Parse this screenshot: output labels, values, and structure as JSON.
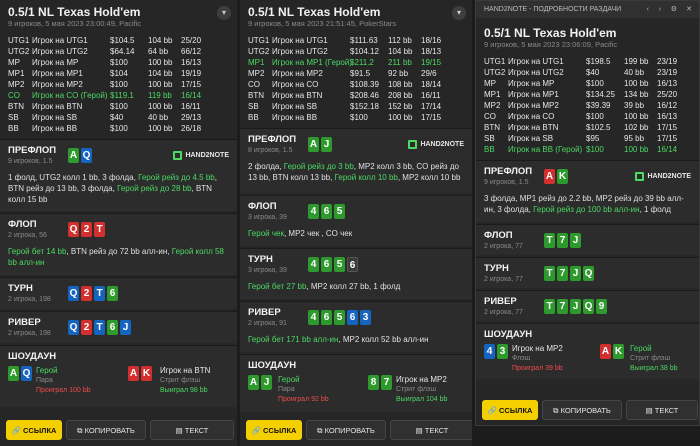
{
  "p1": {
    "title": "0.5/1 NL Texas Hold'em",
    "sub": "9 игроков, 5 мая 2023 23:00:49, Pacific",
    "players": [
      {
        "pos": "UTG1",
        "name": "Игрок на UTG1",
        "stack": "$104.5",
        "bb": "104 bb",
        "ratio": "25/20"
      },
      {
        "pos": "UTG2",
        "name": "Игрок на UTG2",
        "stack": "$64.14",
        "bb": "64 bb",
        "ratio": "66/12"
      },
      {
        "pos": "MP",
        "name": "Игрок на MP",
        "stack": "$100",
        "bb": "100 bb",
        "ratio": "16/13"
      },
      {
        "pos": "MP1",
        "name": "Игрок на MP1",
        "stack": "$104",
        "bb": "104 bb",
        "ratio": "19/19"
      },
      {
        "pos": "MP2",
        "name": "Игрок на MP2",
        "stack": "$100",
        "bb": "100 bb",
        "ratio": "17/15"
      },
      {
        "pos": "CO",
        "name": "Игрок на CO (Герой)",
        "stack": "$119.1",
        "bb": "119 bb",
        "ratio": "16/14",
        "hero": true
      },
      {
        "pos": "BTN",
        "name": "Игрок на BTN",
        "stack": "$100",
        "bb": "100 bb",
        "ratio": "16/11"
      },
      {
        "pos": "SB",
        "name": "Игрок на SB",
        "stack": "$40",
        "bb": "40 bb",
        "ratio": "29/13"
      },
      {
        "pos": "BB",
        "name": "Игрок на BB",
        "stack": "$100",
        "bb": "100 bb",
        "ratio": "26/18"
      }
    ],
    "preflop": {
      "t": "ПРЕФЛОП",
      "s": "9 игроков, 1.5",
      "a1": "1 фолд, UTG2 колл 1 bb, 3 фолда, ",
      "a2": "Герой рейз до 4.5 bb",
      "a3": ", BTN ",
      "a4": "рейз до 13 bb",
      "a5": ", 3 фолда, ",
      "a6": "Герой рейз до 28 bb",
      "a7": ", BTN колл 15 bb"
    },
    "flop": {
      "t": "ФЛОП",
      "s": "2 игрока, 56",
      "a1": "Герой бет 14 bb",
      "a2": ", BTN рейз до 72 bb алл-ин, ",
      "a3": "Герой колл 58 bb алл-ин"
    },
    "turn": {
      "t": "ТУРН",
      "s": "2 игрока, 198"
    },
    "river": {
      "t": "РИВЕР",
      "s": "2 игрока, 198"
    },
    "showdown": {
      "t": "ШОУДАУН",
      "h_name": "Герой",
      "h_desc": "Пара",
      "h_res": "Проиграл 100 bb",
      "v_name": "Игрок на BTN",
      "v_desc": "Стрит флэш",
      "v_res": "Выиграл 98 bb"
    }
  },
  "p2": {
    "title": "0.5/1 NL Texas Hold'em",
    "sub": "9 игроков, 5 мая 2023 21:51:45, PokerStars",
    "players": [
      {
        "pos": "UTG1",
        "name": "Игрок на UTG1",
        "stack": "$111.63",
        "bb": "112 bb",
        "ratio": "18/16"
      },
      {
        "pos": "UTG2",
        "name": "Игрок на UTG2",
        "stack": "$104.12",
        "bb": "104 bb",
        "ratio": "18/13"
      },
      {
        "pos": "MP1",
        "name": "Игрок на MP1 (Герой)",
        "stack": "$211.2",
        "bb": "211 bb",
        "ratio": "19/15",
        "hero": true
      },
      {
        "pos": "MP2",
        "name": "Игрок на MP2",
        "stack": "$91.5",
        "bb": "92 bb",
        "ratio": "29/6"
      },
      {
        "pos": "CO",
        "name": "Игрок на CO",
        "stack": "$108.39",
        "bb": "108 bb",
        "ratio": "18/14"
      },
      {
        "pos": "BTN",
        "name": "Игрок на BTN",
        "stack": "$208.46",
        "bb": "208 bb",
        "ratio": "16/11"
      },
      {
        "pos": "SB",
        "name": "Игрок на SB",
        "stack": "$152.18",
        "stack2": "",
        "bb": "152 bb",
        "ratio": "17/14"
      },
      {
        "pos": "BB",
        "name": "Игрок на BB",
        "stack": "$100",
        "bb": "100 bb",
        "ratio": "17/15"
      }
    ],
    "preflop": {
      "t": "ПРЕФЛОП",
      "s": "8 игроков, 1.5",
      "a1": "2 фолда, ",
      "a2": "Герой рейз до 3 bb",
      "a3": ", MP2 колл 3 bb, CO рейз до 13 bb, BTN колл 13 bb, ",
      "a4": "Герой колл 10 bb",
      "a5": ", MP2 колл 10 bb"
    },
    "flop": {
      "t": "ФЛОП",
      "s": "3 игрока, 39",
      "a1": "Герой чек",
      "a2": ", MP2 чек , CO чек"
    },
    "turn": {
      "t": "ТУРН",
      "s": "3 игрока, 39",
      "a1": "Герой бет 27 bb",
      "a2": ", MP2 колл 27 bb, 1 фолд"
    },
    "river": {
      "t": "РИВЕР",
      "s": "2 игрока, 91",
      "a1": "Герой бет 171 bb алл-ин",
      "a2": ", MP2 колл 52 bb алл-ин"
    },
    "showdown": {
      "t": "ШОУДАУН",
      "h_name": "Герой",
      "h_desc": "Пара",
      "h_res": "Проиграл 92 bb",
      "v_name": "Игрок на MP2",
      "v_desc": "Стрит флэш",
      "v_res": "Выиграл 104 bb"
    }
  },
  "p3": {
    "toolbar": "HAND2NOTE - ПОДРОБНОСТИ РАЗДАЧИ",
    "title": "0.5/1 NL Texas Hold'em",
    "sub": "9 игроков, 5 мая 2023 23:06:09, Pacific",
    "players": [
      {
        "pos": "UTG1",
        "name": "Игрок на UTG1",
        "stack": "$198.5",
        "bb": "199 bb",
        "ratio": "23/19"
      },
      {
        "pos": "UTG2",
        "name": "Игрок на UTG2",
        "stack": "$40",
        "bb": "40 bb",
        "ratio": "23/19"
      },
      {
        "pos": "MP",
        "name": "Игрок на MP",
        "stack": "$100",
        "bb": "100 bb",
        "ratio": "16/13"
      },
      {
        "pos": "MP1",
        "name": "Игрок на MP1",
        "stack": "$134.25",
        "bb": "134 bb",
        "ratio": "25/20"
      },
      {
        "pos": "MP2",
        "name": "Игрок на MP2",
        "stack": "$39.39",
        "bb": "39 bb",
        "ratio": "16/12"
      },
      {
        "pos": "CO",
        "name": "Игрок на CO",
        "stack": "$100",
        "bb": "100 bb",
        "ratio": "16/13"
      },
      {
        "pos": "BTN",
        "name": "Игрок на BTN",
        "stack": "$102.5",
        "bb": "102 bb",
        "ratio": "17/15"
      },
      {
        "pos": "SB",
        "name": "Игрок на SB",
        "stack": "$95",
        "bb": "95 bb",
        "ratio": "17/15"
      },
      {
        "pos": "BB",
        "name": "Игрок на BB (Герой)",
        "stack": "$100",
        "bb": "100 bb",
        "ratio": "16/14",
        "hero": true
      }
    ],
    "preflop": {
      "t": "ПРЕФЛОП",
      "s": "9 игроков, 1.5",
      "a1": "3 фолда, MP1 рейз до 2.2 bb, MP2 рейз до 39 bb алл-ин, 3 фолда, ",
      "a2": "Герой рейз до 100 bb алл-ин",
      "a3": ", 1 фолд"
    },
    "flop": {
      "t": "ФЛОП",
      "s": "2 игрока, 77"
    },
    "turn": {
      "t": "ТУРН",
      "s": "2 игрока, 77"
    },
    "river": {
      "t": "РИВЕР",
      "s": "2 игрока, 77"
    },
    "showdown": {
      "t": "ШОУДАУН",
      "v_name": "Игрок на MP2",
      "v_desc": "Флэш",
      "v_res": "Проиграл 39 bb",
      "h_name": "Герой",
      "h_desc": "Стрит флэш",
      "h_res": "Выиграл 38 bb"
    }
  },
  "buttons": {
    "link": "ССЫЛКА",
    "copy": "КОПИРОВАТЬ",
    "text": "ТЕКСТ"
  },
  "logo": "HAND2NOTE"
}
